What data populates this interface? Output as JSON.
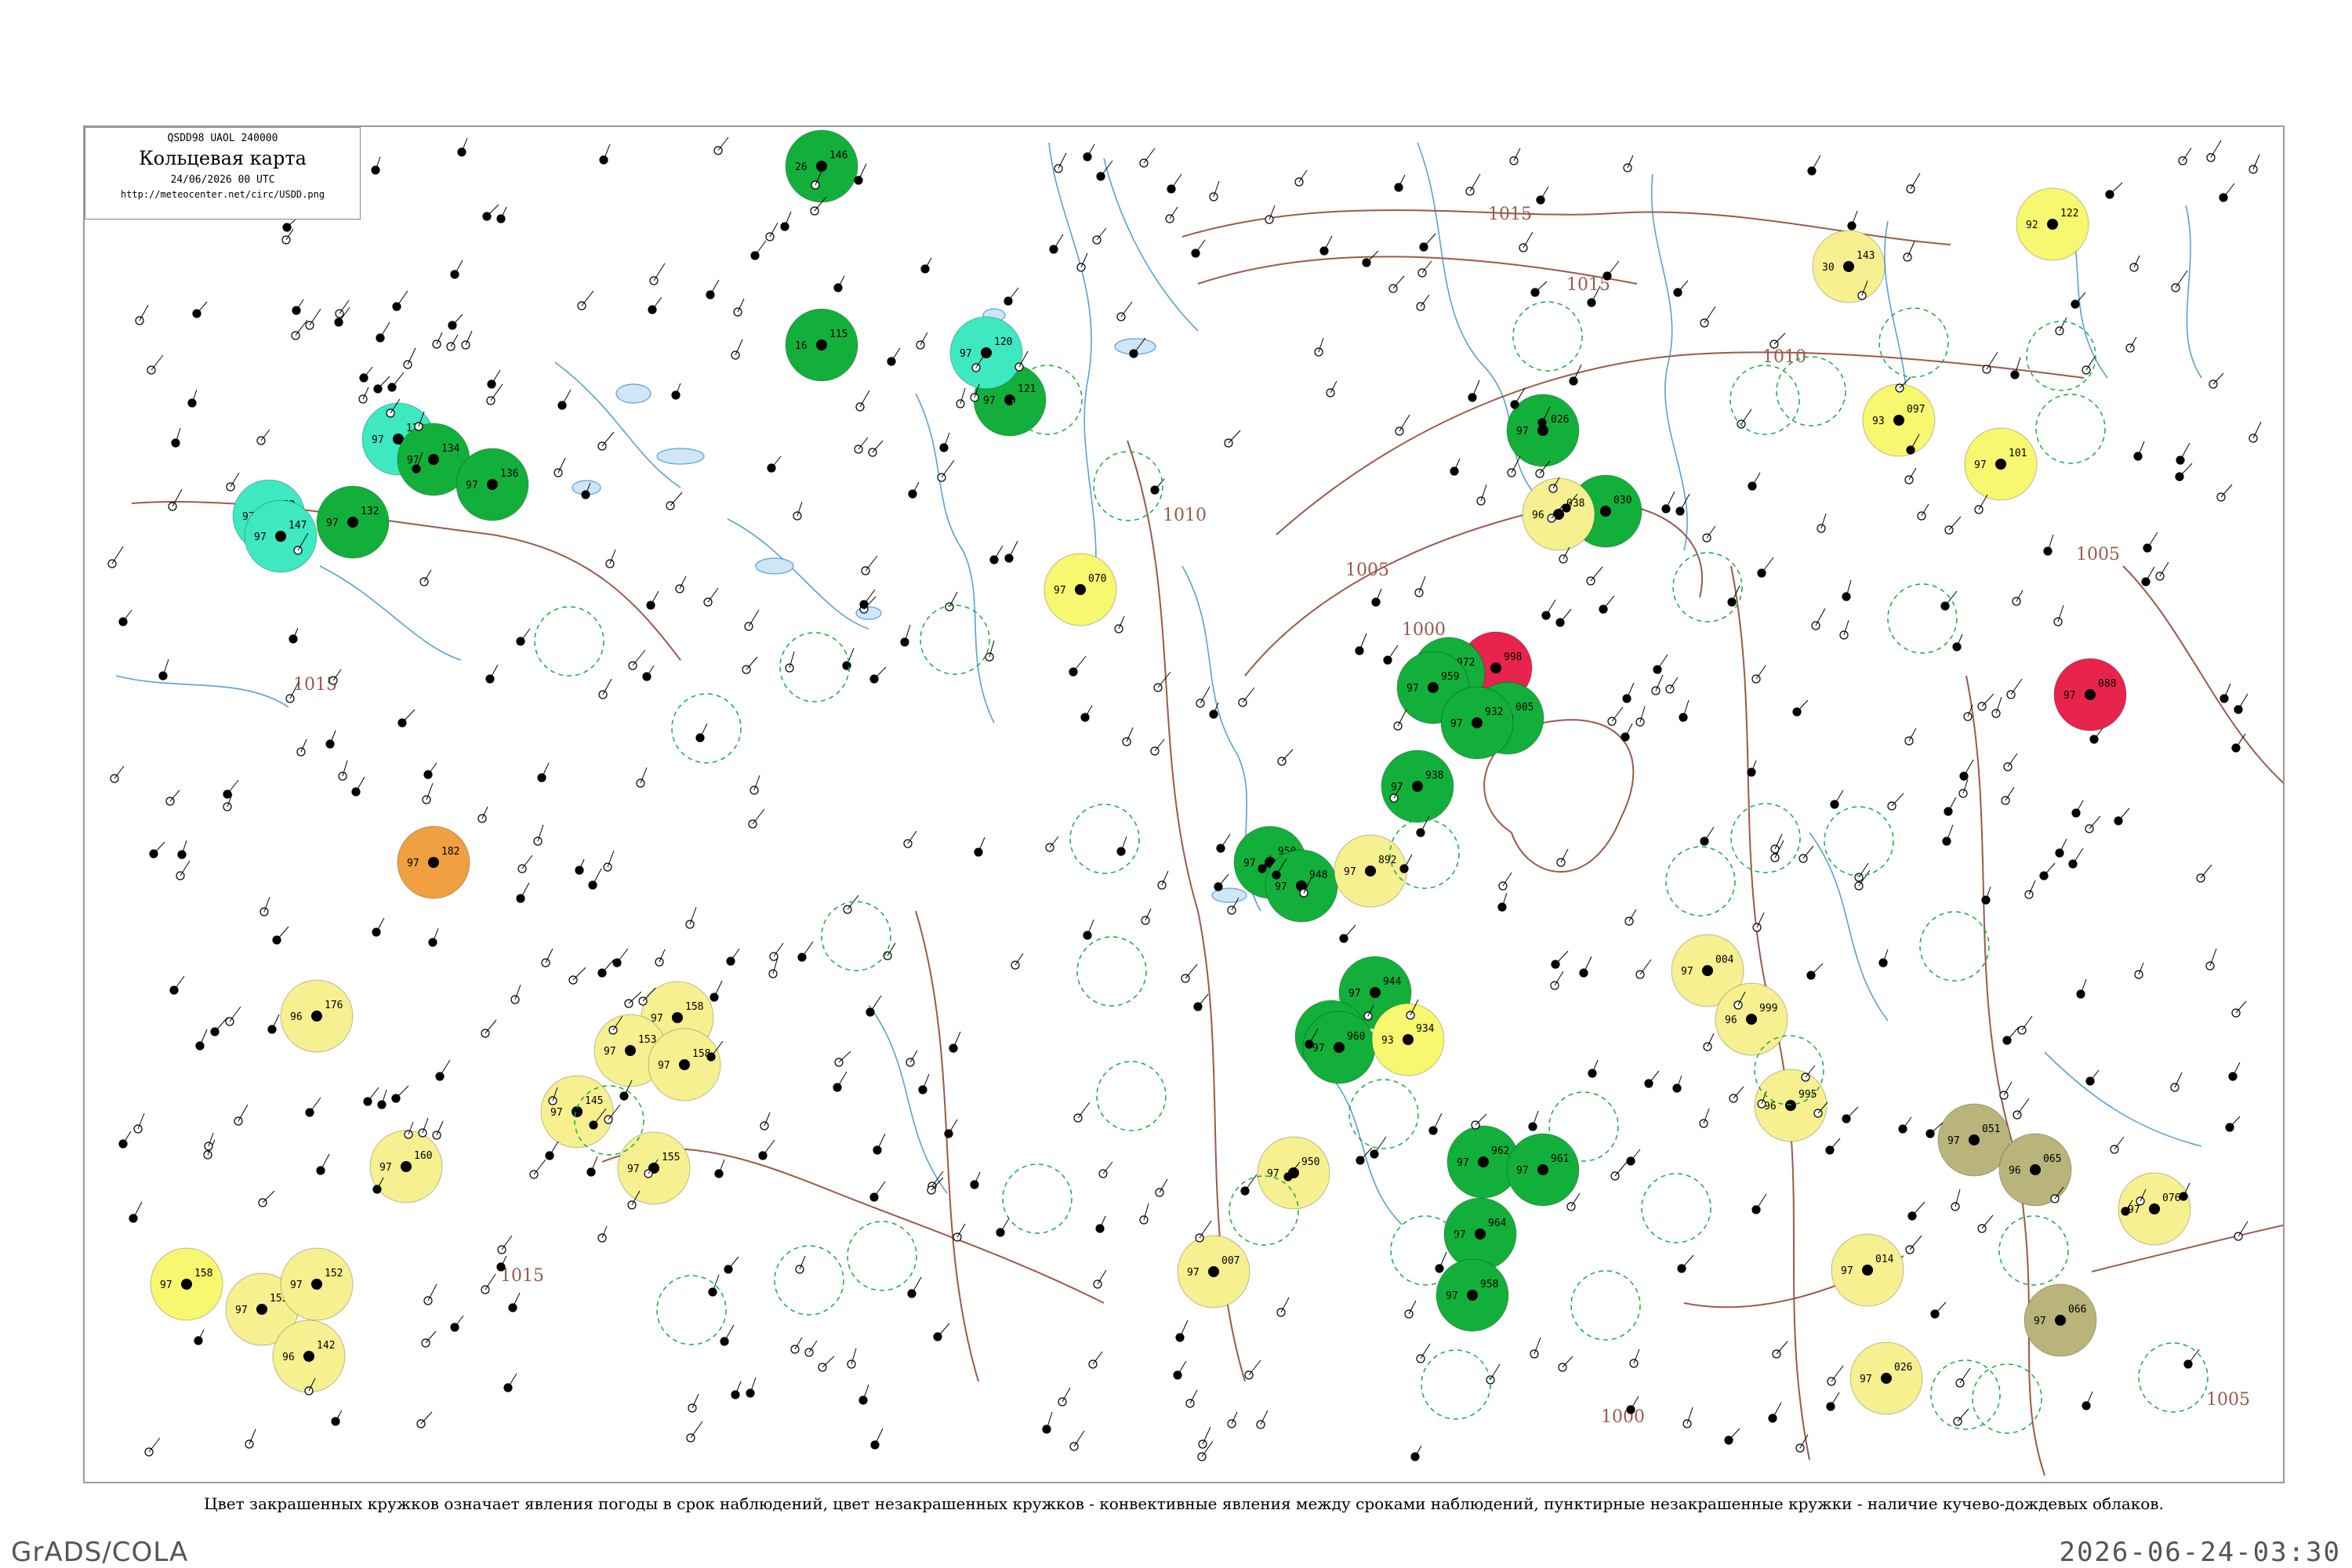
{
  "legend": {
    "code_line": "QSDD98  UAOL  240000",
    "title": "Кольцевая карта",
    "date": "24/06/2026 00 UTC",
    "url": "http://meteocenter.net/circ/USDD.png"
  },
  "caption": "Цвет закрашенных кружков означает явления погоды в срок наблюдений, цвет незакрашенных кружков - конвективные явления между сроками наблюдений, пунктирные незакрашенные кружки - наличие кучево-дождевых облаков.",
  "footer": {
    "left": "GrADS/COLA",
    "right": "2026-06-24-03:30"
  },
  "colors": {
    "isobar": "#9b5a4a",
    "water": "#5aa0d8",
    "rain": "#12b03a",
    "shower": "#3ee8c0",
    "fog_haze": "#f6f090",
    "drizzle": "#f8f870",
    "thunder": "#e8244c",
    "dust": "#b8b47a",
    "smoke": "#f0a040"
  },
  "isobars": [
    {
      "label": "1015"
    },
    {
      "label": "1015"
    },
    {
      "label": "1010"
    },
    {
      "label": "1010"
    },
    {
      "label": "1005"
    },
    {
      "label": "1000"
    },
    {
      "label": "1005"
    },
    {
      "label": "1015"
    },
    {
      "label": "1005"
    },
    {
      "label": "1000"
    },
    {
      "label": "1015"
    }
  ],
  "stations": [
    {
      "type": "rain",
      "p": "146",
      "t": "26"
    },
    {
      "type": "rain",
      "p": "115",
      "t": "16"
    },
    {
      "type": "shower",
      "p": "130",
      "t": "97"
    },
    {
      "type": "rain",
      "p": "134",
      "t": "97"
    },
    {
      "type": "rain",
      "p": "136",
      "t": "97"
    },
    {
      "type": "shower",
      "p": "152",
      "t": "97"
    },
    {
      "type": "shower",
      "p": "147",
      "t": "97"
    },
    {
      "type": "rain",
      "p": "132",
      "t": "97"
    },
    {
      "type": "rain",
      "p": "121",
      "t": "97"
    },
    {
      "type": "shower",
      "p": "120",
      "t": "97"
    },
    {
      "type": "drizzle",
      "p": "070",
      "t": "97"
    },
    {
      "type": "rain",
      "p": "026",
      "t": "97"
    },
    {
      "type": "rain",
      "p": "030",
      "t": "97"
    },
    {
      "type": "fog_haze",
      "p": "038",
      "t": "96"
    },
    {
      "type": "thunder",
      "p": "998",
      "t": "97"
    },
    {
      "type": "rain",
      "p": "005",
      "t": "97"
    },
    {
      "type": "rain",
      "p": "972",
      "t": "97"
    },
    {
      "type": "rain",
      "p": "959",
      "t": "97"
    },
    {
      "type": "rain",
      "p": "932",
      "t": "97"
    },
    {
      "type": "rain",
      "p": "938",
      "t": "97"
    },
    {
      "type": "rain",
      "p": "950",
      "t": "97"
    },
    {
      "type": "rain",
      "p": "948",
      "t": "97"
    },
    {
      "type": "rain",
      "p": "944",
      "t": "97"
    },
    {
      "type": "rain",
      "p": "950",
      "t": "97"
    },
    {
      "type": "rain",
      "p": "960",
      "t": "97"
    },
    {
      "type": "drizzle",
      "p": "934",
      "t": "93"
    },
    {
      "type": "rain",
      "p": "962",
      "t": "97"
    },
    {
      "type": "rain",
      "p": "964",
      "t": "97"
    },
    {
      "type": "rain",
      "p": "958",
      "t": "97"
    },
    {
      "type": "rain",
      "p": "961",
      "t": "97"
    },
    {
      "type": "fog_haze",
      "p": "892",
      "t": "97"
    },
    {
      "type": "drizzle",
      "p": "122",
      "t": "92"
    },
    {
      "type": "fog_haze",
      "p": "143",
      "t": "30"
    },
    {
      "type": "drizzle",
      "p": "097",
      "t": "93"
    },
    {
      "type": "drizzle",
      "p": "101",
      "t": "97"
    },
    {
      "type": "thunder",
      "p": "088",
      "t": "97"
    },
    {
      "type": "fog_haze",
      "p": "004",
      "t": "97"
    },
    {
      "type": "fog_haze",
      "p": "999",
      "t": "96"
    },
    {
      "type": "fog_haze",
      "p": "995",
      "t": "96"
    },
    {
      "type": "dust",
      "p": "051",
      "t": "97"
    },
    {
      "type": "dust",
      "p": "065",
      "t": "96"
    },
    {
      "type": "fog_haze",
      "p": "076",
      "t": "97"
    },
    {
      "type": "dust",
      "p": "066",
      "t": "97"
    },
    {
      "type": "fog_haze",
      "p": "014",
      "t": "97"
    },
    {
      "type": "fog_haze",
      "p": "026",
      "t": "97"
    },
    {
      "type": "smoke",
      "p": "182",
      "t": "97"
    },
    {
      "type": "fog_haze",
      "p": "176",
      "t": "96"
    },
    {
      "type": "fog_haze",
      "p": "158",
      "t": "97"
    },
    {
      "type": "fog_haze",
      "p": "153",
      "t": "97"
    },
    {
      "type": "fog_haze",
      "p": "158",
      "t": "97"
    },
    {
      "type": "fog_haze",
      "p": "145",
      "t": "97"
    },
    {
      "type": "fog_haze",
      "p": "155",
      "t": "97"
    },
    {
      "type": "fog_haze",
      "p": "160",
      "t": "97"
    },
    {
      "type": "drizzle",
      "p": "158",
      "t": "97"
    },
    {
      "type": "fog_haze",
      "p": "155",
      "t": "97"
    },
    {
      "type": "fog_haze",
      "p": "152",
      "t": "97"
    },
    {
      "type": "fog_haze",
      "p": "142",
      "t": "96"
    },
    {
      "type": "fog_haze",
      "p": "007",
      "t": "97"
    },
    {
      "type": "fog_haze",
      "p": "950",
      "t": "97"
    }
  ]
}
